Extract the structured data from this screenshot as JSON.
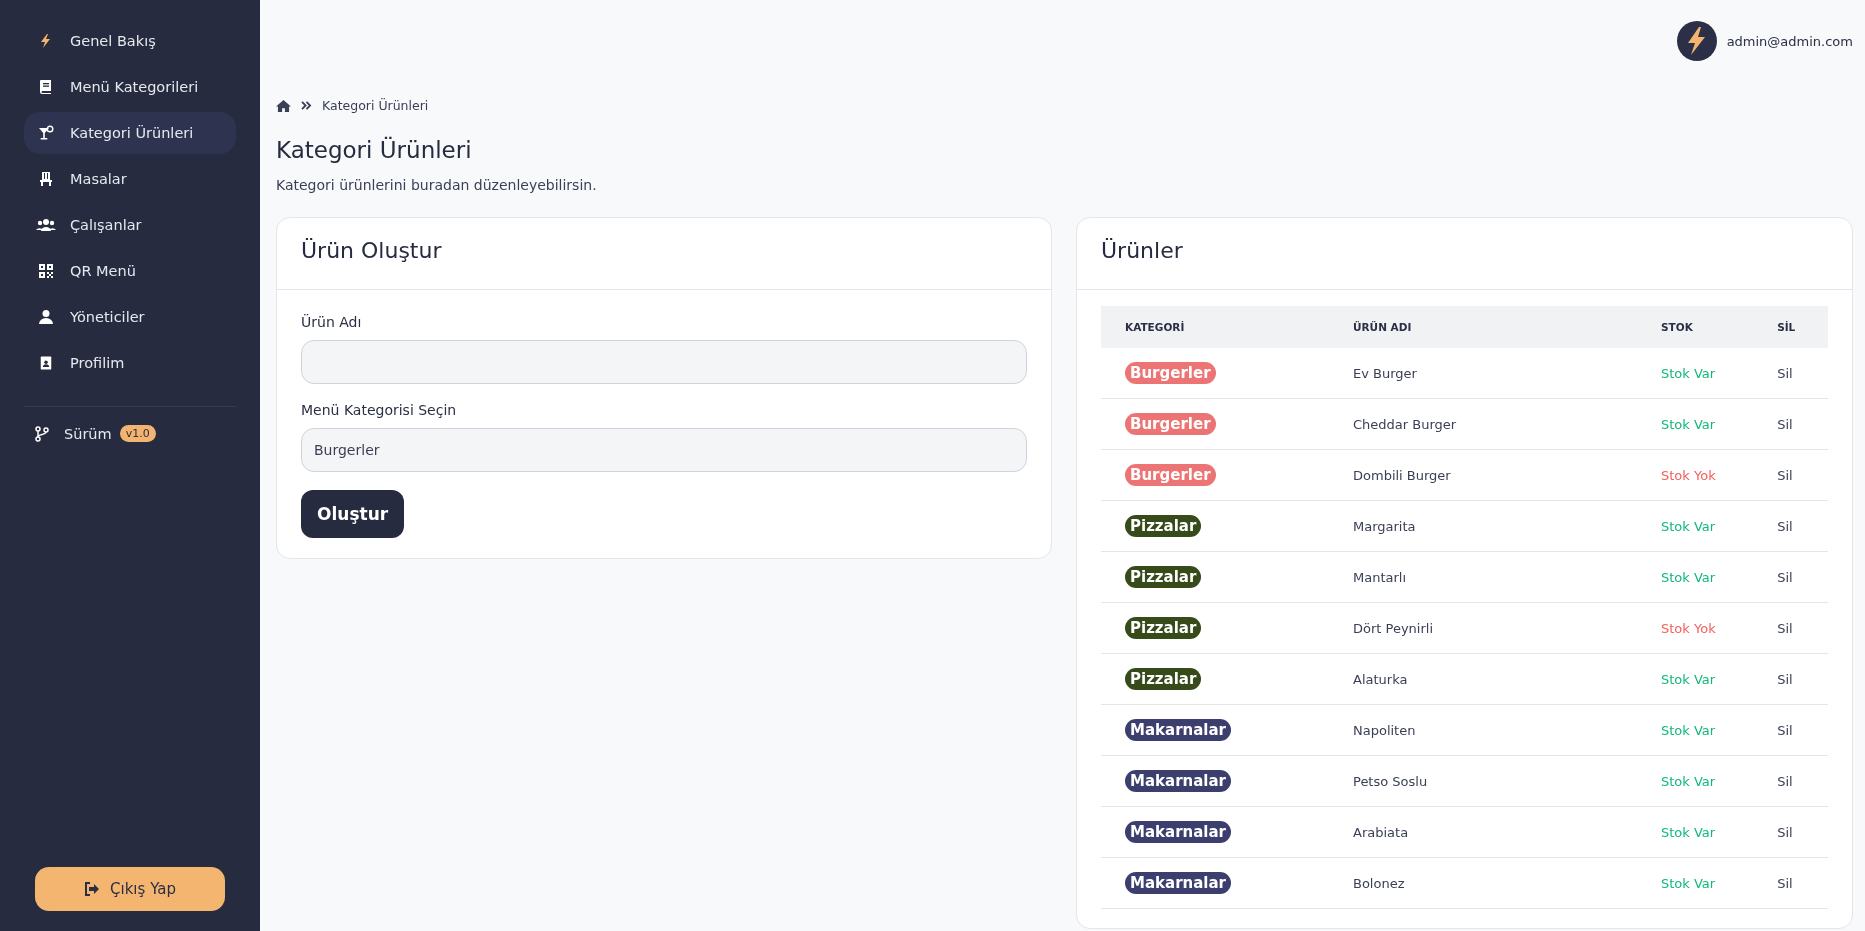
{
  "sidebar": {
    "items": [
      {
        "label": "Genel Bakış",
        "kind": "bolt",
        "selected": false
      },
      {
        "label": "Menü Kategorileri",
        "kind": "book",
        "selected": false
      },
      {
        "label": "Kategori Ürünleri",
        "kind": "glass",
        "selected": true
      },
      {
        "label": "Masalar",
        "kind": "chair",
        "selected": false
      },
      {
        "label": "Çalışanlar",
        "kind": "users",
        "selected": false
      },
      {
        "label": "QR Menü",
        "kind": "qr",
        "selected": false
      },
      {
        "label": "Yöneticiler",
        "kind": "user",
        "selected": false
      },
      {
        "label": "Profilim",
        "kind": "idcard",
        "selected": false
      }
    ],
    "version": {
      "label": "Sürüm",
      "badge": "v1.0"
    },
    "logout": "Çıkış Yap"
  },
  "header": {
    "user_email": "admin@admin.com"
  },
  "breadcrumb": {
    "current": "Kategori Ürünleri"
  },
  "page": {
    "title": "Kategori Ürünleri",
    "subtitle": "Kategori ürünlerini buradan düzenleyebilirsin."
  },
  "form": {
    "title": "Ürün Oluştur",
    "fields": [
      {
        "kind": "text",
        "label": "Ürün Adı"
      },
      {
        "kind": "select",
        "label": "Menü Kategorisi Seçin",
        "value": "Burgerler"
      }
    ],
    "submit": "Oluştur"
  },
  "products": {
    "title": "Ürünler",
    "columns": [
      "KATEGORİ",
      "ÜRÜN ADI",
      "STOK",
      "SİL"
    ],
    "rows": [
      {
        "category": "Burgerler",
        "color": "#ec7474",
        "name": "Ev Burger",
        "stock": "Stok Var",
        "in_stock": true,
        "action": "Sil"
      },
      {
        "category": "Burgerler",
        "color": "#ec7474",
        "name": "Cheddar Burger",
        "stock": "Stok Var",
        "in_stock": true,
        "action": "Sil"
      },
      {
        "category": "Burgerler",
        "color": "#ec7474",
        "name": "Dombili Burger",
        "stock": "Stok Yok",
        "in_stock": false,
        "action": "Sil"
      },
      {
        "category": "Pizzalar",
        "color": "#364a1a",
        "name": "Margarita",
        "stock": "Stok Var",
        "in_stock": true,
        "action": "Sil"
      },
      {
        "category": "Pizzalar",
        "color": "#364a1a",
        "name": "Mantarlı",
        "stock": "Stok Var",
        "in_stock": true,
        "action": "Sil"
      },
      {
        "category": "Pizzalar",
        "color": "#364a1a",
        "name": "Dört Peynirli",
        "stock": "Stok Yok",
        "in_stock": false,
        "action": "Sil"
      },
      {
        "category": "Pizzalar",
        "color": "#364a1a",
        "name": "Alaturka",
        "stock": "Stok Var",
        "in_stock": true,
        "action": "Sil"
      },
      {
        "category": "Makarnalar",
        "color": "#3c3e6e",
        "name": "Napoliten",
        "stock": "Stok Var",
        "in_stock": true,
        "action": "Sil"
      },
      {
        "category": "Makarnalar",
        "color": "#3c3e6e",
        "name": "Petso Soslu",
        "stock": "Stok Var",
        "in_stock": true,
        "action": "Sil"
      },
      {
        "category": "Makarnalar",
        "color": "#3c3e6e",
        "name": "Arabiata",
        "stock": "Stok Var",
        "in_stock": true,
        "action": "Sil"
      },
      {
        "category": "Makarnalar",
        "color": "#3c3e6e",
        "name": "Bolonez",
        "stock": "Stok Var",
        "in_stock": true,
        "action": "Sil"
      }
    ]
  }
}
